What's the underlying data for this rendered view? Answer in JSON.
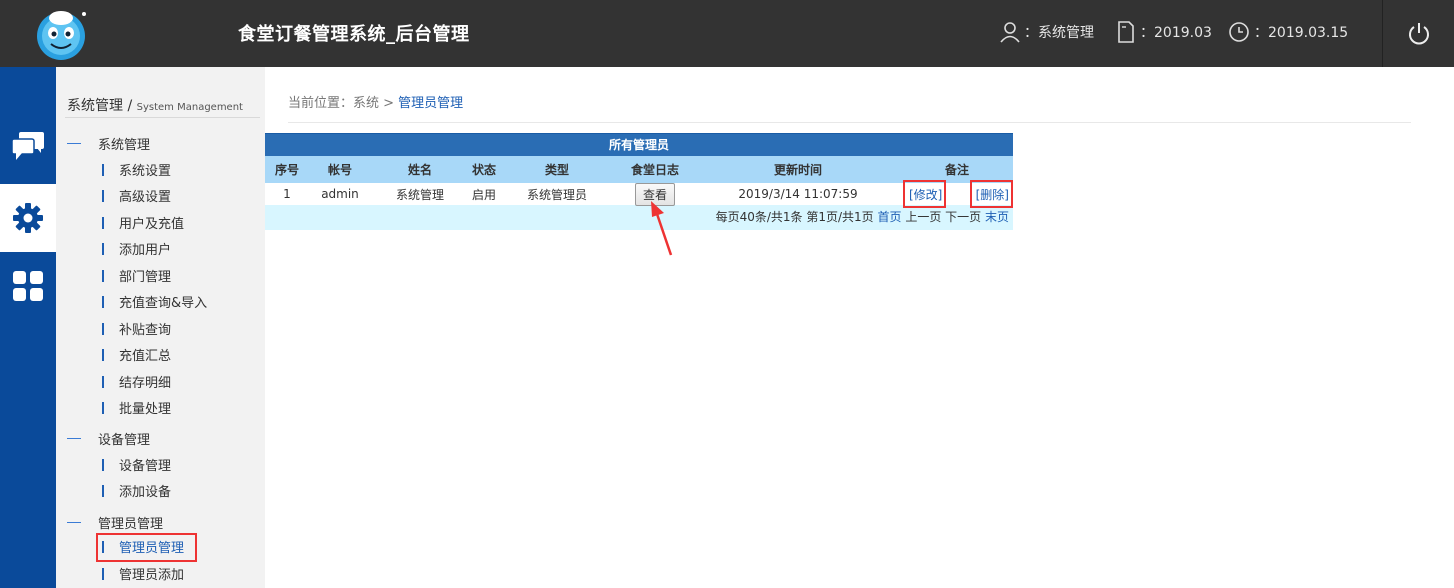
{
  "header": {
    "title": "食堂订餐管理系统_后台管理",
    "user_label": "：系统管理",
    "version_label": "：2019.03",
    "date_label": "：2019.03.15",
    "icons": [
      "logo-mascot",
      "user-icon",
      "document-icon",
      "clock-icon",
      "power-icon"
    ]
  },
  "rail": {
    "items": [
      {
        "name": "chat-icon",
        "active": false
      },
      {
        "name": "gear-icon",
        "active": true
      },
      {
        "name": "grid-icon",
        "active": false
      }
    ]
  },
  "sidebar": {
    "title": "系统管理",
    "title_sep": " / ",
    "title_en": "System Management",
    "groups": [
      {
        "label": "系统管理",
        "items": [
          "系统设置",
          "高级设置",
          "用户及充值",
          "添加用户",
          "部门管理",
          "充值查询&导入",
          "补贴查询",
          "充值汇总",
          "结存明细",
          "批量处理"
        ]
      },
      {
        "label": "设备管理",
        "items": [
          "设备管理",
          "添加设备"
        ]
      },
      {
        "label": "管理员管理",
        "items": [
          "管理员管理",
          "管理员添加"
        ]
      }
    ],
    "active_item": "管理员管理"
  },
  "breadcrumb": {
    "prefix": "当前位置：系统 > ",
    "current": "管理员管理"
  },
  "table": {
    "caption": "所有管理员",
    "headers": [
      "序号",
      "帐号",
      "姓名",
      "状态",
      "类型",
      "食堂日志",
      "更新时间",
      "备注"
    ],
    "rows": [
      {
        "index": "1",
        "account": "admin",
        "name": "系统管理",
        "status": "启用",
        "type": "系统管理员",
        "log_button": "查看",
        "updated": "2019/3/14 11:07:59",
        "edit": "[修改]",
        "delete": "[删除]"
      }
    ],
    "footer": {
      "summary": "每页40条/共1条 第1页/共1页 ",
      "first": "首页",
      "prev": " 上一页 ",
      "next": "下一页 ",
      "last": "末页"
    }
  },
  "colors": {
    "header_bg": "#333333",
    "rail_bg": "#0a4a9a",
    "caption_bg": "#2a6db4",
    "head_bg": "#a8d8f8",
    "footer_bg": "#d8f6ff",
    "highlight": "#e33333"
  }
}
